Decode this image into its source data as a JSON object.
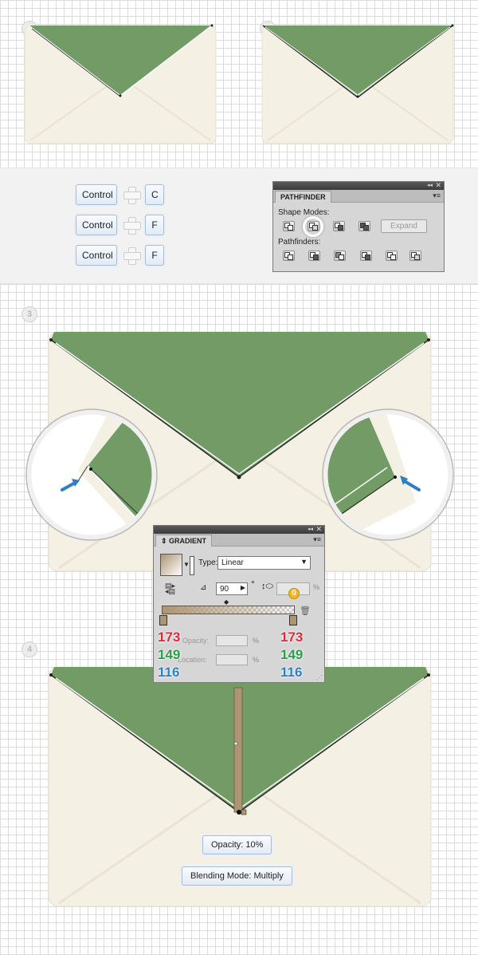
{
  "steps": [
    "1",
    "2",
    "3",
    "4"
  ],
  "shortcuts": [
    {
      "modifier": "Control",
      "key": "C"
    },
    {
      "modifier": "Control",
      "key": "F"
    },
    {
      "modifier": "Control",
      "key": "F"
    }
  ],
  "pathfinder": {
    "title": "PATHFINDER",
    "shape_modes_label": "Shape Modes:",
    "pathfinders_label": "Pathfinders:",
    "expand_label": "Expand"
  },
  "gradient": {
    "title": "GRADIENT",
    "type_label": "Type:",
    "type_value": "Linear",
    "angle_value": "90",
    "degree_symbol": "°",
    "aspect_badge": "0",
    "percent": "%",
    "opacity_label": "Opacity:",
    "location_label": "Location:",
    "left_stop_rgb": [
      "173",
      "149",
      "116"
    ],
    "right_stop_rgb": [
      "173",
      "149",
      "116"
    ]
  },
  "labels": {
    "opacity": "Opacity: 10%",
    "blending": "Blending Mode: Multiply"
  },
  "colors": {
    "flap_green": "#739b66",
    "envelope_cream": "#f4f0e4",
    "gradient_stop": "#ad9574"
  }
}
